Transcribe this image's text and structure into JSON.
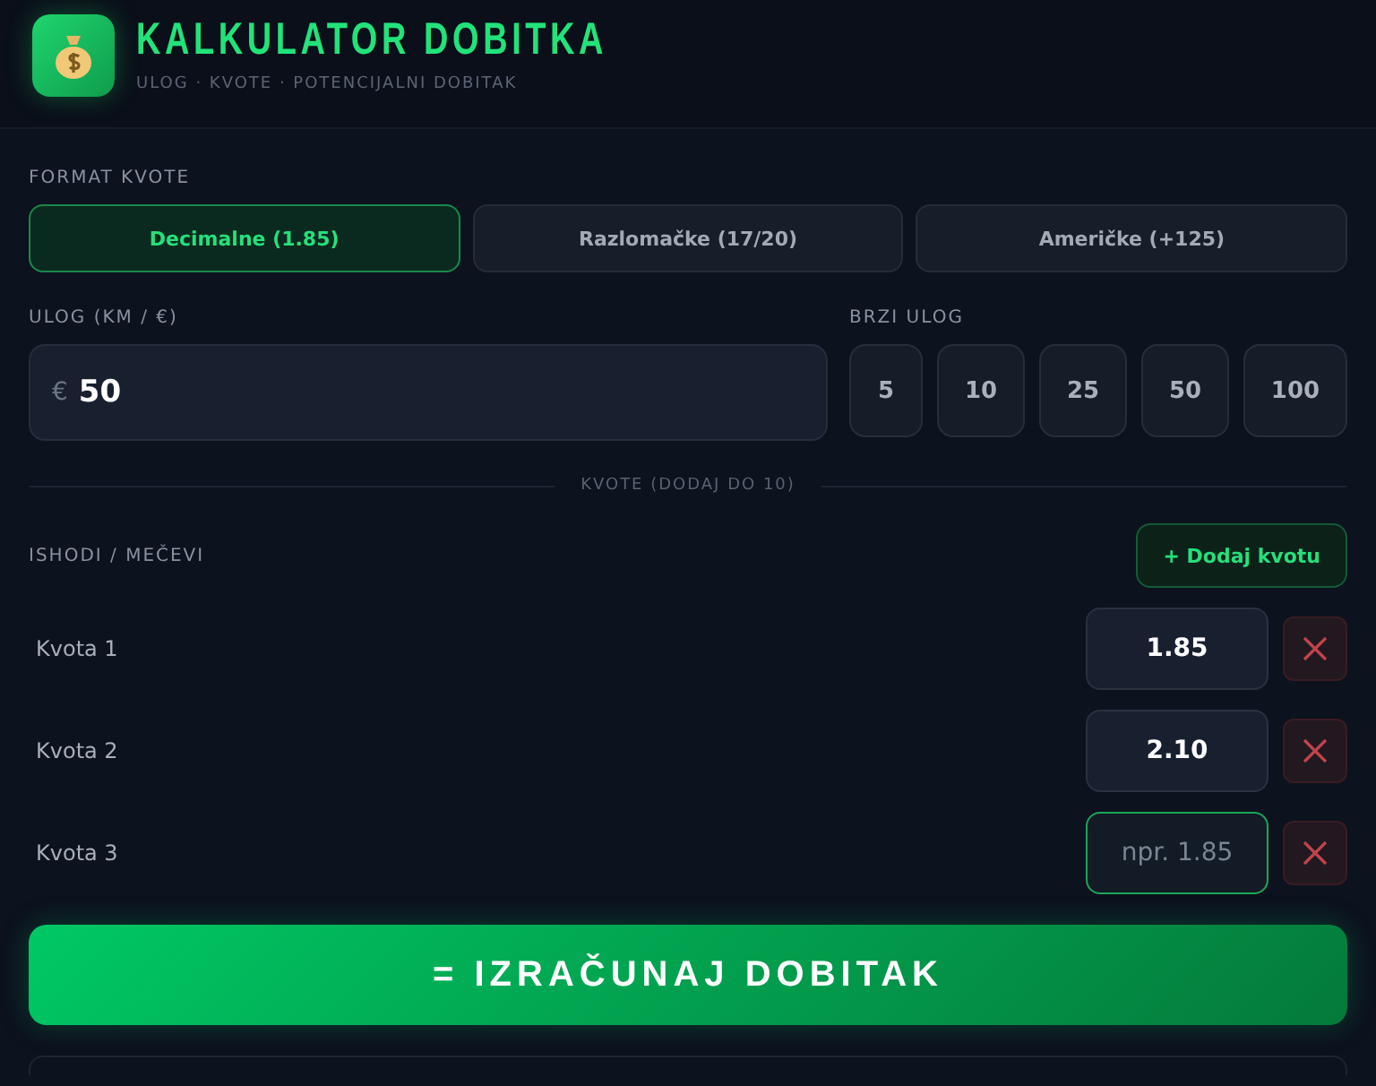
{
  "header": {
    "title": "KALKULATOR DOBITKA",
    "subtitle": "ULOG · KVOTE · POTENCIJALNI DOBITAK"
  },
  "format": {
    "label": "FORMAT KVOTE",
    "options": [
      {
        "label": "Decimalne (1.85)",
        "selected": true
      },
      {
        "label": "Razlomačke (17/20)",
        "selected": false
      },
      {
        "label": "Američke (+125)",
        "selected": false
      }
    ]
  },
  "stake": {
    "label": "ULOG (KM / €)",
    "currency": "€",
    "value": "50"
  },
  "quick_stake": {
    "label": "BRZI ULOG",
    "amounts": [
      "5",
      "10",
      "25",
      "50",
      "100"
    ]
  },
  "odds_divider": "KVOTE (DODAJ DO 10)",
  "outcomes": {
    "label": "ISHODI / MEČEVI",
    "add_button": "+ Dodaj kvotu",
    "rows": [
      {
        "name": "Kvota 1",
        "value": "1.85",
        "focused": false
      },
      {
        "name": "Kvota 2",
        "value": "2.10",
        "focused": false
      },
      {
        "name": "Kvota 3",
        "placeholder": "npr. 1.85",
        "focused": true
      }
    ]
  },
  "calculate_button": "= IZRAČUNAJ DOBITAK"
}
